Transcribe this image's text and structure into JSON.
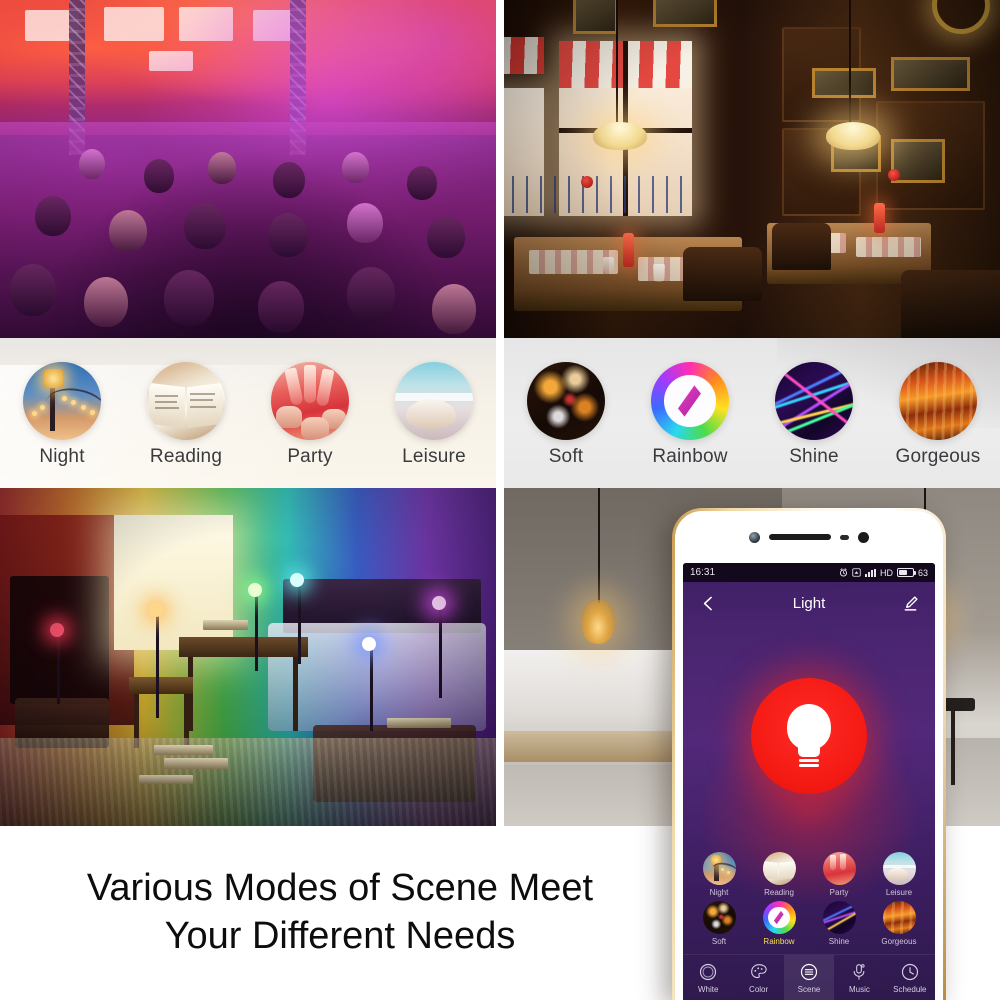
{
  "headline": {
    "line1": "Various Modes of Scene Meet",
    "line2": "Your Different Needs"
  },
  "scene_strip": {
    "left": [
      {
        "label": "Night",
        "icon": "night-scene-icon"
      },
      {
        "label": "Reading",
        "icon": "reading-scene-icon"
      },
      {
        "label": "Party",
        "icon": "party-scene-icon"
      },
      {
        "label": "Leisure",
        "icon": "leisure-scene-icon"
      }
    ],
    "right": [
      {
        "label": "Soft",
        "icon": "soft-scene-icon"
      },
      {
        "label": "Rainbow",
        "icon": "rainbow-scene-icon"
      },
      {
        "label": "Shine",
        "icon": "shine-scene-icon"
      },
      {
        "label": "Gorgeous",
        "icon": "gorgeous-scene-icon"
      }
    ]
  },
  "phone": {
    "status_bar": {
      "time": "16:31",
      "alarm_icon": "alarm-clock-icon",
      "signal_icon": "signal-icon",
      "bars_icon": "signal-bars-icon",
      "network": "HD",
      "battery_icon": "battery-icon",
      "battery_level": "63"
    },
    "header": {
      "back_icon": "back-arrow-icon",
      "title": "Light",
      "edit_icon": "edit-pencil-icon"
    },
    "power": {
      "icon": "light-bulb-icon",
      "state_color": "#f51b15"
    },
    "scenes": [
      {
        "label": "Night",
        "icon": "night-scene-icon",
        "active": false
      },
      {
        "label": "Reading",
        "icon": "reading-scene-icon",
        "active": false
      },
      {
        "label": "Party",
        "icon": "party-scene-icon",
        "active": false
      },
      {
        "label": "Leisure",
        "icon": "leisure-scene-icon",
        "active": false
      },
      {
        "label": "Soft",
        "icon": "soft-scene-icon",
        "active": false
      },
      {
        "label": "Rainbow",
        "icon": "rainbow-scene-icon",
        "active": true
      },
      {
        "label": "Shine",
        "icon": "shine-scene-icon",
        "active": false
      },
      {
        "label": "Gorgeous",
        "icon": "gorgeous-scene-icon",
        "active": false
      }
    ],
    "tabs": [
      {
        "label": "White",
        "icon": "white-circle-icon",
        "active": false
      },
      {
        "label": "Color",
        "icon": "color-palette-icon",
        "active": false
      },
      {
        "label": "Scene",
        "icon": "scene-list-icon",
        "active": true
      },
      {
        "label": "Music",
        "icon": "music-mic-icon",
        "active": false
      },
      {
        "label": "Schedule",
        "icon": "schedule-clock-icon",
        "active": false
      }
    ],
    "accent_active_color": "#f2e04a"
  },
  "photos": [
    {
      "name": "concert-crowd-photo",
      "caption": ""
    },
    {
      "name": "restaurant-interior-photo",
      "caption": ""
    },
    {
      "name": "rainbow-lit-room-photo",
      "caption": ""
    },
    {
      "name": "modern-bedroom-photo",
      "caption": ""
    }
  ]
}
